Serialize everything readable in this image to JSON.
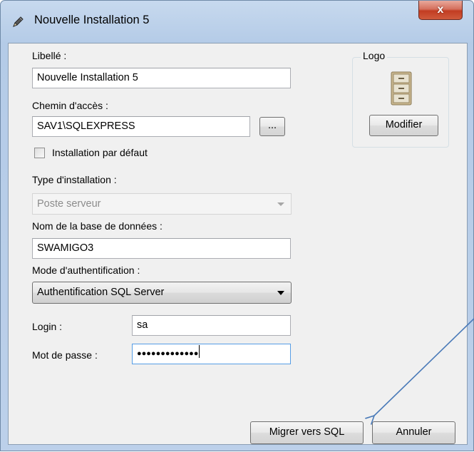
{
  "window": {
    "title": "Nouvelle Installation 5",
    "close_label": "x"
  },
  "form": {
    "libelle_label": "Libellé :",
    "libelle_value": "Nouvelle Installation 5",
    "chemin_label": "Chemin d'accès :",
    "chemin_value": "SAV1\\SQLEXPRESS",
    "browse_label": "...",
    "default_checkbox_label": "Installation par défaut",
    "default_checked": false,
    "type_label": "Type d'installation :",
    "type_value": "Poste serveur",
    "db_label": "Nom de la base de données :",
    "db_value": "SWAMIGO3",
    "auth_label": "Mode d'authentification :",
    "auth_value": "Authentification SQL Server",
    "login_label": "Login :",
    "login_value": "sa",
    "password_label": "Mot de passe :",
    "password_value": "●●●●●●●●●●●●●"
  },
  "logo_group": {
    "title": "Logo",
    "icon": "filing-cabinet-icon",
    "modify_label": "Modifier"
  },
  "footer": {
    "migrate_label": "Migrer vers SQL",
    "cancel_label": "Annuler"
  },
  "colors": {
    "annotation_arrow": "#4a7ab8",
    "close_button": "#c94a30"
  }
}
